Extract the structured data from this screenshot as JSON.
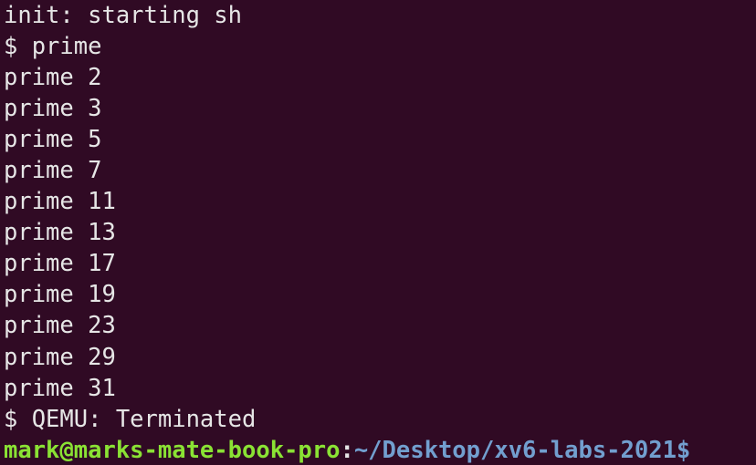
{
  "terminal": {
    "lines": [
      "init: starting sh",
      "$ prime",
      "prime 2",
      "prime 3",
      "prime 5",
      "prime 7",
      "prime 11",
      "prime 13",
      "prime 17",
      "prime 19",
      "prime 23",
      "prime 29",
      "prime 31",
      "$ QEMU: Terminated"
    ],
    "prompt": {
      "user_host": "mark@marks-mate-book-pro",
      "separator": ":",
      "path": "~/Desktop/xv6-labs-2021$"
    }
  },
  "colors": {
    "background": "#300a24",
    "text": "#e6e6e6",
    "user_host": "#8ae234",
    "path": "#729fcf"
  }
}
